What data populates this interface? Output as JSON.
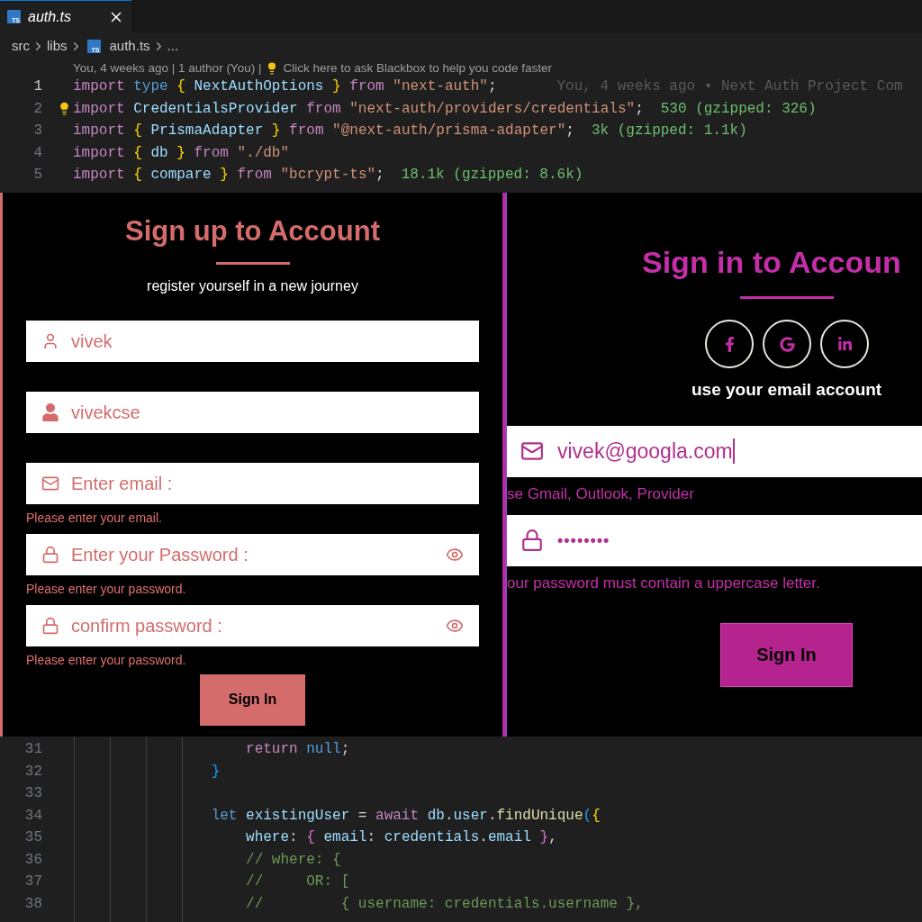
{
  "editor": {
    "tab": {
      "title": "auth.ts",
      "badge": "TS"
    },
    "breadcrumb": [
      {
        "label": "src",
        "kind": "folder"
      },
      {
        "label": "libs",
        "kind": "folder"
      },
      {
        "label": "auth.ts",
        "kind": "file",
        "badge": "TS"
      },
      {
        "label": "...",
        "kind": "more"
      }
    ],
    "codelens": {
      "info": "You, 4 weeks ago | 1 author (You) |",
      "action": "Click here to ask Blackbox to help you code faster"
    },
    "top_lines": [
      {
        "number": "1",
        "current": true,
        "tokens": [
          {
            "t": "import",
            "kind": "kw"
          },
          {
            "t": " type ",
            "kind": "st"
          },
          {
            "t": "{",
            "kind": "b1"
          },
          {
            "t": " NextAuthOptions ",
            "kind": "id"
          },
          {
            "t": "}",
            "kind": "b1"
          },
          {
            "t": " from ",
            "kind": "kw"
          },
          {
            "t": "\"next-auth\"",
            "kind": "str"
          },
          {
            "t": ";",
            "kind": "pl"
          }
        ],
        "blame": "You, 4 weeks ago • Next Auth Project Com"
      },
      {
        "number": "2",
        "current": false,
        "bulb": true,
        "tokens": [
          {
            "t": "import",
            "kind": "kw"
          },
          {
            "t": " CredentialsProvider ",
            "kind": "id"
          },
          {
            "t": "from ",
            "kind": "kw"
          },
          {
            "t": "\"next-auth/providers/credentials\"",
            "kind": "str"
          },
          {
            "t": ";",
            "kind": "pl"
          }
        ],
        "size": "530 (gzipped: 326)"
      },
      {
        "number": "3",
        "current": false,
        "tokens": [
          {
            "t": "import ",
            "kind": "kw"
          },
          {
            "t": "{",
            "kind": "b1"
          },
          {
            "t": " PrismaAdapter ",
            "kind": "id"
          },
          {
            "t": "}",
            "kind": "b1"
          },
          {
            "t": " from ",
            "kind": "kw"
          },
          {
            "t": "\"@next-auth/prisma-adapter\"",
            "kind": "str"
          },
          {
            "t": ";",
            "kind": "pl"
          }
        ],
        "size": "3k (gzipped: 1.1k)"
      },
      {
        "number": "4",
        "current": false,
        "tokens": [
          {
            "t": "import ",
            "kind": "kw"
          },
          {
            "t": "{",
            "kind": "b1"
          },
          {
            "t": " db ",
            "kind": "id"
          },
          {
            "t": "}",
            "kind": "b1"
          },
          {
            "t": " from ",
            "kind": "kw"
          },
          {
            "t": "\"./db\"",
            "kind": "str"
          }
        ]
      },
      {
        "number": "5",
        "current": false,
        "tokens": [
          {
            "t": "import ",
            "kind": "kw"
          },
          {
            "t": "{",
            "kind": "b1"
          },
          {
            "t": " compare ",
            "kind": "id"
          },
          {
            "t": "}",
            "kind": "b1"
          },
          {
            "t": " from ",
            "kind": "kw"
          },
          {
            "t": "\"bcrypt-ts\"",
            "kind": "str"
          },
          {
            "t": ";",
            "kind": "pl"
          }
        ],
        "size": "18.1k (gzipped: 8.6k)"
      }
    ],
    "bottom_lines": [
      {
        "number": "31",
        "tokens": [
          {
            "t": "                    return",
            "kind": "kw"
          },
          {
            "t": " null",
            "kind": "st"
          },
          {
            "t": ";",
            "kind": "pl"
          }
        ]
      },
      {
        "number": "32",
        "tokens": [
          {
            "t": "                }",
            "kind": "b3"
          }
        ]
      },
      {
        "number": "33"
      },
      {
        "number": "34",
        "tokens": [
          {
            "t": "                let",
            "kind": "st"
          },
          {
            "t": " existingUser ",
            "kind": "id"
          },
          {
            "t": "= ",
            "kind": "pl"
          },
          {
            "t": "await ",
            "kind": "kw"
          },
          {
            "t": "db",
            "kind": "id"
          },
          {
            "t": ".",
            "kind": "pl"
          },
          {
            "t": "user",
            "kind": "id"
          },
          {
            "t": ".",
            "kind": "pl"
          },
          {
            "t": "findUnique",
            "kind": "fn"
          },
          {
            "t": "(",
            "kind": "b3"
          },
          {
            "t": "{",
            "kind": "b1"
          }
        ]
      },
      {
        "number": "35",
        "tokens": [
          {
            "t": "                    where",
            "kind": "id"
          },
          {
            "t": ": ",
            "kind": "pl"
          },
          {
            "t": "{",
            "kind": "b2"
          },
          {
            "t": " email",
            "kind": "id"
          },
          {
            "t": ": ",
            "kind": "pl"
          },
          {
            "t": "credentials",
            "kind": "id"
          },
          {
            "t": ".",
            "kind": "pl"
          },
          {
            "t": "email ",
            "kind": "id"
          },
          {
            "t": "}",
            "kind": "b2"
          },
          {
            "t": ",",
            "kind": "pl"
          }
        ]
      },
      {
        "number": "36",
        "tokens": [
          {
            "t": "                    // where: {",
            "kind": "cm"
          }
        ]
      },
      {
        "number": "37",
        "tokens": [
          {
            "t": "                    //     OR: [",
            "kind": "cm"
          }
        ]
      },
      {
        "number": "38",
        "tokens": [
          {
            "t": "                    //         { username: credentials.username },",
            "kind": "cm"
          }
        ]
      }
    ]
  },
  "signup": {
    "title": "Sign up to Account",
    "subtitle": "register yourself in a new journey",
    "fields": [
      {
        "kind": "user",
        "value": "vivek"
      },
      {
        "kind": "user-solid",
        "value": "vivekcse"
      },
      {
        "kind": "mail",
        "placeholder": "Enter email :",
        "error": "Please enter your email."
      },
      {
        "kind": "lock",
        "placeholder": "Enter your Password :",
        "reveal": true,
        "error": "Please enter your password."
      },
      {
        "kind": "lock",
        "placeholder": "confirm password :",
        "reveal": true,
        "error": "Please enter your password."
      }
    ],
    "button": "Sign In"
  },
  "signin": {
    "title": "Sign in to Accoun",
    "subtitle": "use your email account",
    "fields": [
      {
        "kind": "mail",
        "value": "vivek@googla.com",
        "focused": true,
        "hint": "se Gmail, Outlook, Provider"
      },
      {
        "kind": "lock",
        "value": "••••••••",
        "focused": false,
        "hint": "our password must contain a uppercase letter."
      }
    ],
    "button": "Sign In"
  }
}
